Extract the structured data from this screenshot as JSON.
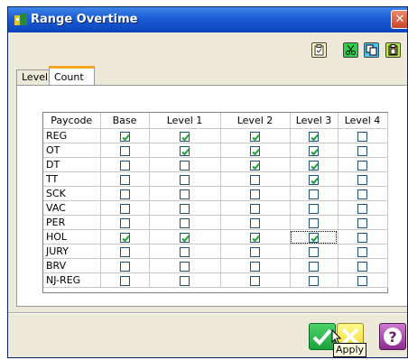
{
  "window": {
    "title": "Range Overtime",
    "close_label": "✕"
  },
  "toolbar": {
    "buttons": [
      "clipboard-icon",
      "cut-icon",
      "copy-icon",
      "paste-icon"
    ]
  },
  "tabs": [
    {
      "label": "Level",
      "active": false
    },
    {
      "label": "Count",
      "active": true
    }
  ],
  "grid": {
    "headers": [
      "Paycode",
      "Base",
      "Level 1",
      "Level 2",
      "Level 3",
      "Level 4"
    ],
    "rows": [
      {
        "code": "REG",
        "checks": [
          true,
          true,
          true,
          true,
          false
        ]
      },
      {
        "code": "OT",
        "checks": [
          false,
          true,
          true,
          true,
          false
        ]
      },
      {
        "code": "DT",
        "checks": [
          false,
          false,
          true,
          true,
          false
        ]
      },
      {
        "code": "TT",
        "checks": [
          false,
          false,
          false,
          true,
          false
        ]
      },
      {
        "code": "SCK",
        "checks": [
          false,
          false,
          false,
          false,
          false
        ]
      },
      {
        "code": "VAC",
        "checks": [
          false,
          false,
          false,
          false,
          false
        ]
      },
      {
        "code": "PER",
        "checks": [
          false,
          false,
          false,
          false,
          false
        ]
      },
      {
        "code": "HOL",
        "checks": [
          true,
          true,
          true,
          true,
          false
        ]
      },
      {
        "code": "JURY",
        "checks": [
          false,
          false,
          false,
          false,
          false
        ]
      },
      {
        "code": "BRV",
        "checks": [
          false,
          false,
          false,
          false,
          false
        ]
      },
      {
        "code": "NJ-REG",
        "checks": [
          false,
          false,
          false,
          false,
          false
        ]
      }
    ],
    "focused_cell": {
      "row": 7,
      "col": 3
    }
  },
  "footer": {
    "tooltip": "Apply",
    "help_label": "?"
  },
  "colors": {
    "titlebar": "#1a5bd4",
    "tab_accent": "#f5a623",
    "check": "#1fa13a"
  }
}
